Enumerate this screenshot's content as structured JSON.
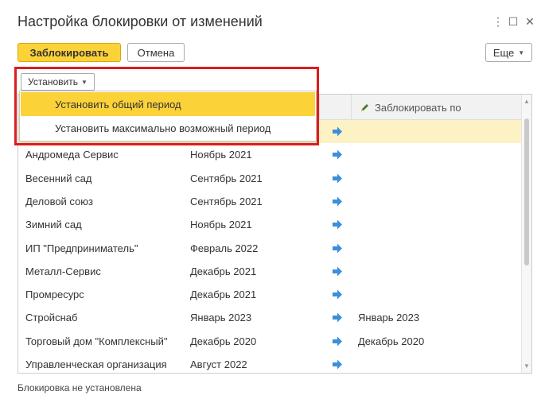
{
  "window": {
    "title": "Настройка блокировки от изменений",
    "controls": {
      "more": "⋮",
      "maximize": "☐",
      "close": "✕"
    }
  },
  "toolbar": {
    "lock_label": "Заблокировать",
    "cancel_label": "Отмена",
    "more_label": "Еще"
  },
  "set_button": {
    "label": "Установить"
  },
  "menu": {
    "items": [
      {
        "label": "Установить общий период",
        "active": true
      },
      {
        "label": "Установить максимально возможный период",
        "active": false
      }
    ]
  },
  "table": {
    "lock_column_header": "Заблокировать по",
    "rows": [
      {
        "org": "",
        "period": "",
        "lock_by": ""
      },
      {
        "org": "Андромеда Сервис",
        "period": "Ноябрь 2021",
        "lock_by": ""
      },
      {
        "org": "Весенний сад",
        "period": "Сентябрь 2021",
        "lock_by": ""
      },
      {
        "org": "Деловой союз",
        "period": "Сентябрь 2021",
        "lock_by": ""
      },
      {
        "org": "Зимний сад",
        "period": "Ноябрь 2021",
        "lock_by": ""
      },
      {
        "org": "ИП \"Предприниматель\"",
        "period": "Февраль 2022",
        "lock_by": ""
      },
      {
        "org": "Металл-Сервис",
        "period": "Декабрь 2021",
        "lock_by": ""
      },
      {
        "org": "Промресурс",
        "period": "Декабрь 2021",
        "lock_by": ""
      },
      {
        "org": "Стройснаб",
        "period": "Январь 2023",
        "lock_by": "Январь 2023"
      },
      {
        "org": "Торговый дом \"Комплексный\"",
        "period": "Декабрь 2020",
        "lock_by": "Декабрь 2020"
      },
      {
        "org": "Управленческая организация",
        "period": "Август 2022",
        "lock_by": ""
      }
    ]
  },
  "status": {
    "text": "Блокировка не установлена"
  },
  "colors": {
    "accent": "#fbd238",
    "highlight_border": "#e01b1b",
    "arrow": "#3d8fd9",
    "selected_row": "#fdf2c6"
  }
}
